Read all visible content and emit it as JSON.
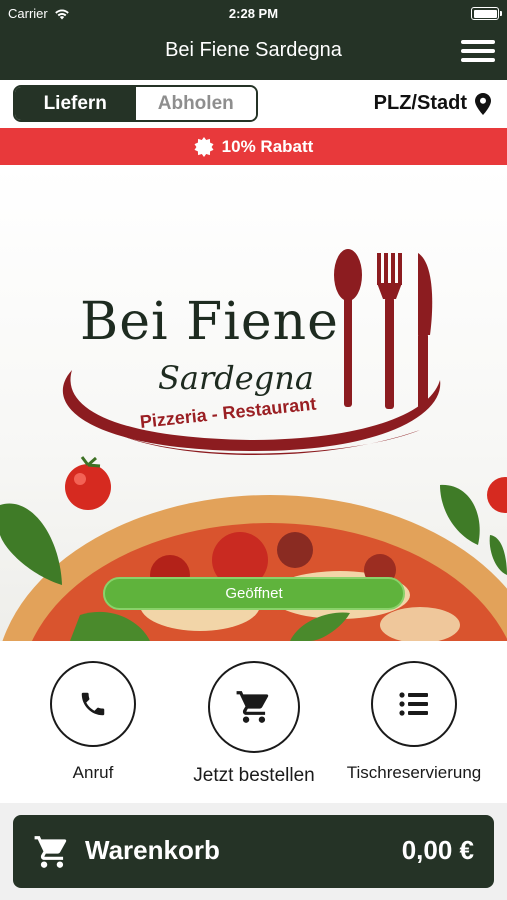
{
  "status_bar": {
    "carrier": "Carrier",
    "time": "2:28 PM"
  },
  "header": {
    "title": "Bei Fiene Sardegna"
  },
  "delivery_toggle": {
    "options": [
      "Liefern",
      "Abholen"
    ],
    "selected": "Liefern"
  },
  "location": {
    "label": "PLZ/Stadt"
  },
  "discount_banner": {
    "text": "10% Rabatt"
  },
  "hero": {
    "brand_name": "Bei Fiene",
    "brand_sub": "Sardegna",
    "brand_tagline": "Pizzeria - Restaurant",
    "status_badge": "Geöffnet"
  },
  "actions": [
    {
      "label": "Anruf",
      "icon": "phone-icon"
    },
    {
      "label": "Jetzt bestellen",
      "icon": "cart-icon"
    },
    {
      "label": "Tischreservierung",
      "icon": "list-icon"
    }
  ],
  "cart": {
    "label": "Warenkorb",
    "total": "0,00 €"
  },
  "colors": {
    "primary": "#253326",
    "discount": "#e8393b",
    "open": "#5fb33c",
    "brand_red": "#9a1f23"
  }
}
